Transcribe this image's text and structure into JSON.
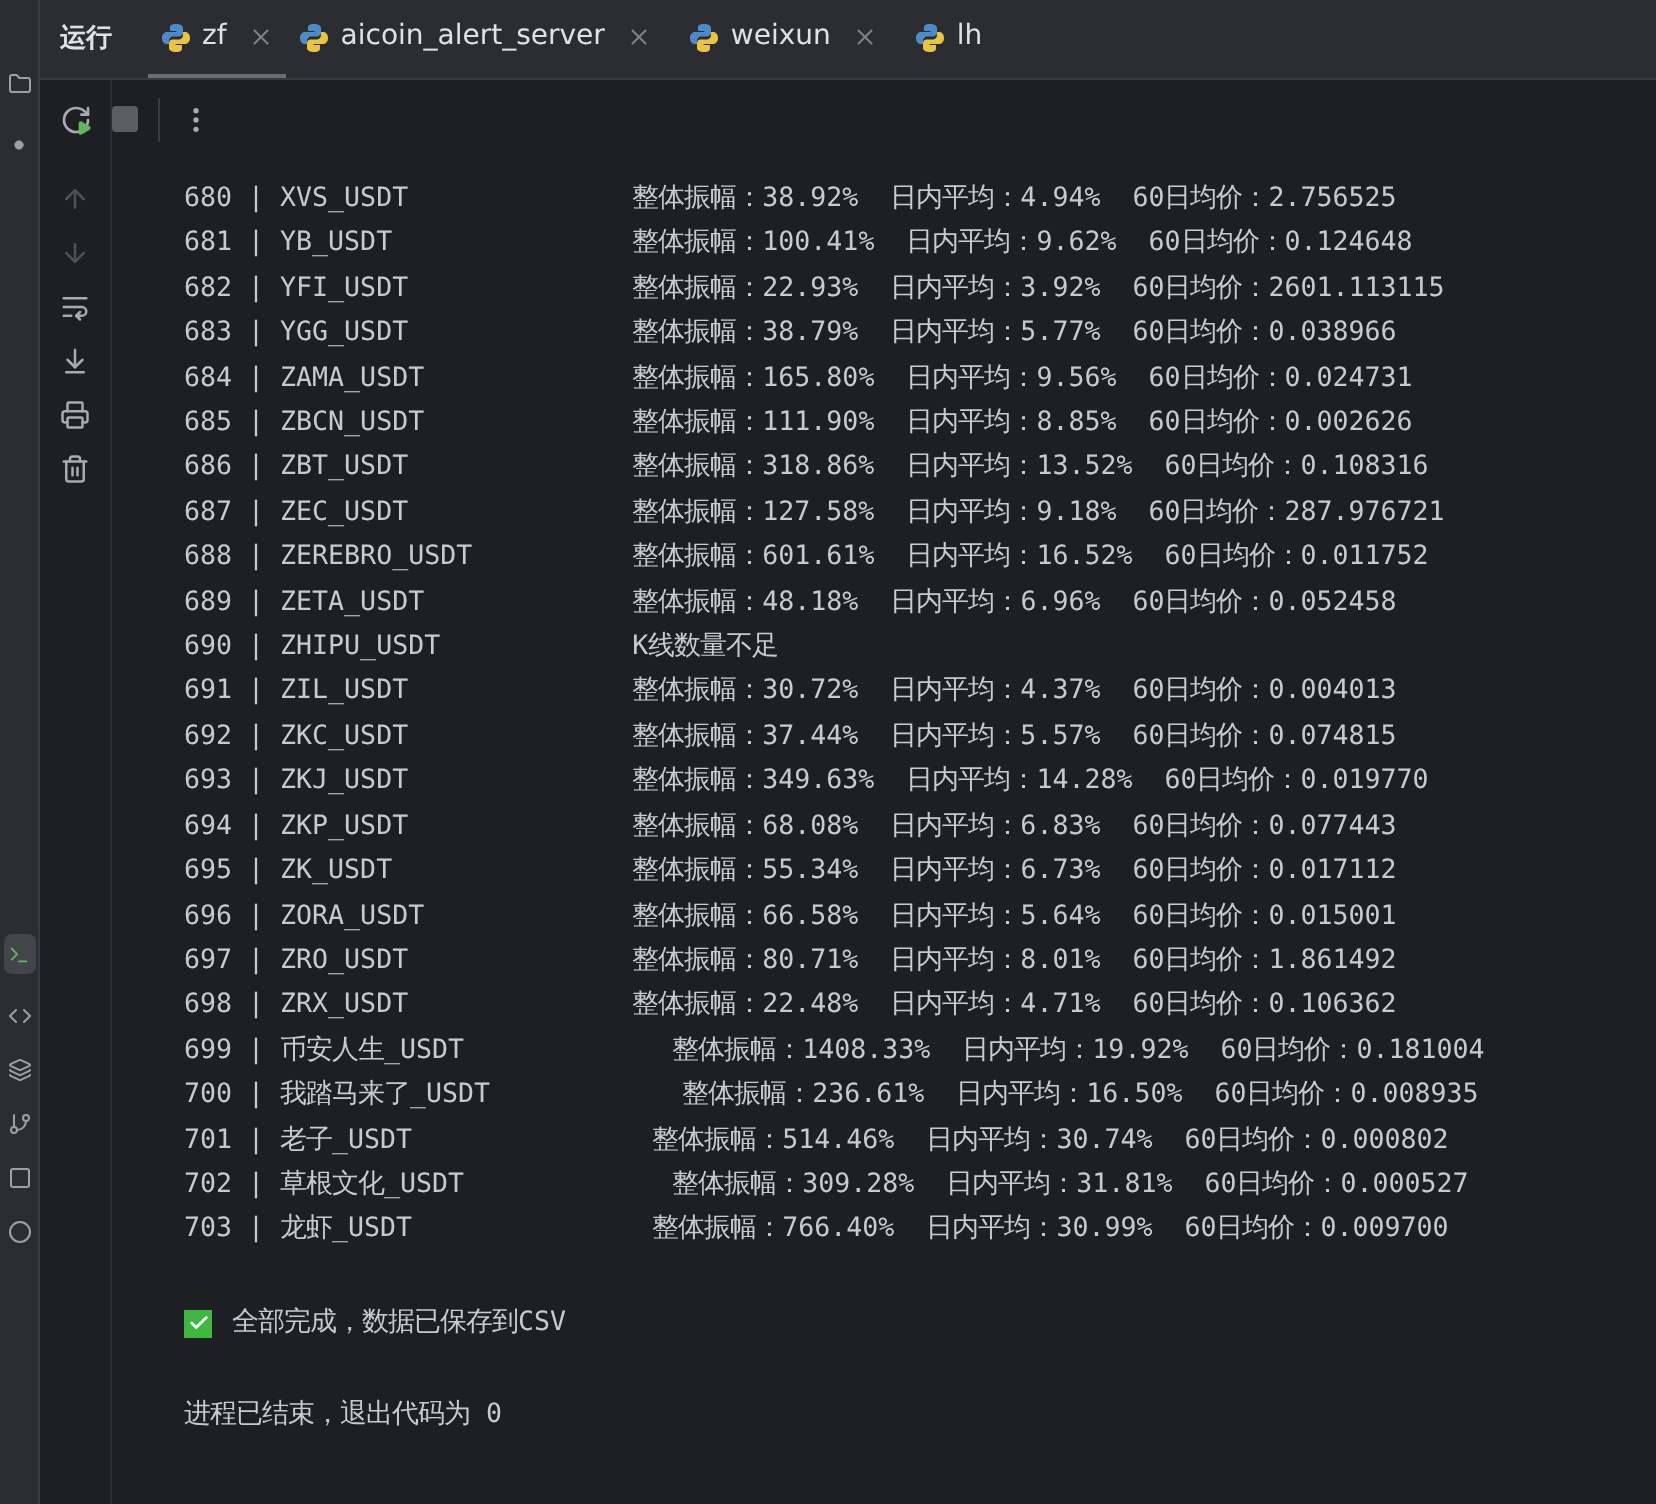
{
  "run_panel": {
    "title": "运行"
  },
  "tabs": [
    {
      "label": "zf",
      "selected": true,
      "closable": true
    },
    {
      "label": "aicoin_alert_server",
      "selected": false,
      "closable": true
    },
    {
      "label": "weixun",
      "selected": false,
      "closable": true
    },
    {
      "label": "lh",
      "selected": false,
      "closable": false
    }
  ],
  "console": {
    "rows": [
      {
        "line": "680 | XVS_USDT",
        "detail": "整体振幅：38.92%  日内平均：4.94%  60日均价：2.756525"
      },
      {
        "line": "681 | YB_USDT",
        "detail": "整体振幅：100.41%  日内平均：9.62%  60日均价：0.124648"
      },
      {
        "line": "682 | YFI_USDT",
        "detail": "整体振幅：22.93%  日内平均：3.92%  60日均价：2601.113115"
      },
      {
        "line": "683 | YGG_USDT",
        "detail": "整体振幅：38.79%  日内平均：5.77%  60日均价：0.038966"
      },
      {
        "line": "684 | ZAMA_USDT",
        "detail": "整体振幅：165.80%  日内平均：9.56%  60日均价：0.024731"
      },
      {
        "line": "685 | ZBCN_USDT",
        "detail": "整体振幅：111.90%  日内平均：8.85%  60日均价：0.002626"
      },
      {
        "line": "686 | ZBT_USDT",
        "detail": "整体振幅：318.86%  日内平均：13.52%  60日均价：0.108316"
      },
      {
        "line": "687 | ZEC_USDT",
        "detail": "整体振幅：127.58%  日内平均：9.18%  60日均价：287.976721"
      },
      {
        "line": "688 | ZEREBRO_USDT",
        "detail": "整体振幅：601.61%  日内平均：16.52%  60日均价：0.011752"
      },
      {
        "line": "689 | ZETA_USDT",
        "detail": "整体振幅：48.18%  日内平均：6.96%  60日均价：0.052458"
      },
      {
        "line": "690 | ZHIPU_USDT",
        "detail": "K线数量不足"
      },
      {
        "line": "691 | ZIL_USDT",
        "detail": "整体振幅：30.72%  日内平均：4.37%  60日均价：0.004013"
      },
      {
        "line": "692 | ZKC_USDT",
        "detail": "整体振幅：37.44%  日内平均：5.57%  60日均价：0.074815"
      },
      {
        "line": "693 | ZKJ_USDT",
        "detail": "整体振幅：349.63%  日内平均：14.28%  60日均价：0.019770"
      },
      {
        "line": "694 | ZKP_USDT",
        "detail": "整体振幅：68.08%  日内平均：6.83%  60日均价：0.077443"
      },
      {
        "line": "695 | ZK_USDT",
        "detail": "整体振幅：55.34%  日内平均：6.73%  60日均价：0.017112"
      },
      {
        "line": "696 | ZORA_USDT",
        "detail": "整体振幅：66.58%  日内平均：5.64%  60日均价：0.015001"
      },
      {
        "line": "697 | ZRO_USDT",
        "detail": "整体振幅：80.71%  日内平均：8.01%  60日均价：1.861492"
      },
      {
        "line": "698 | ZRX_USDT",
        "detail": "整体振幅：22.48%  日内平均：4.71%  60日均价：0.106362"
      },
      {
        "line": "699 | 币安人生_USDT",
        "detail": "整体振幅：1408.33%  日内平均：19.92%  60日均价：0.181004"
      },
      {
        "line": "700 | 我踏马来了_USDT",
        "detail": "整体振幅：236.61%  日内平均：16.50%  60日均价：0.008935"
      },
      {
        "line": "701 | 老子_USDT",
        "detail": "整体振幅：514.46%  日内平均：30.74%  60日均价：0.000802"
      },
      {
        "line": "702 | 草根文化_USDT",
        "detail": "整体振幅：309.28%  日内平均：31.81%  60日均价：0.000527"
      },
      {
        "line": "703 | 龙虾_USDT",
        "detail": "整体振幅：766.40%  日内平均：30.99%  60日均价：0.009700"
      }
    ],
    "done_message": "全部完成，数据已保存到CSV",
    "exit_message": "进程已结束，退出代码为 0"
  }
}
